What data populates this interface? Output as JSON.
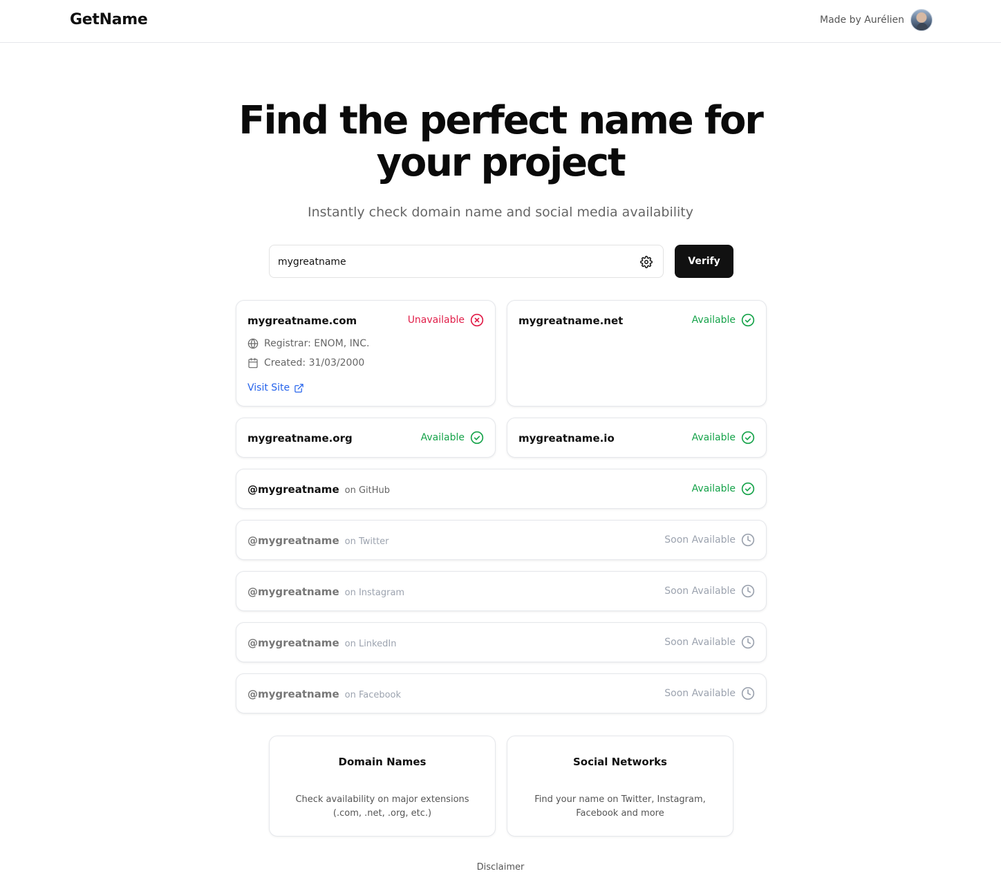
{
  "header": {
    "brand": "GetName",
    "made_by": "Made by Aurélien"
  },
  "hero": {
    "title": "Find the perfect name for your project",
    "subtitle": "Instantly check domain name and social media availability"
  },
  "search": {
    "value": "mygreatname",
    "verify_label": "Verify"
  },
  "domains": [
    {
      "name": "mygreatname.com",
      "status": "Unavailable",
      "registrar": "Registrar: ENOM, INC.",
      "created": "Created: 31/03/2000",
      "visit_label": "Visit Site"
    },
    {
      "name": "mygreatname.net",
      "status": "Available"
    },
    {
      "name": "mygreatname.org",
      "status": "Available"
    },
    {
      "name": "mygreatname.io",
      "status": "Available"
    }
  ],
  "socials": [
    {
      "handle": "@mygreatname",
      "platform": "on GitHub",
      "status": "Available"
    },
    {
      "handle": "@mygreatname",
      "platform": "on Twitter",
      "status": "Soon Available"
    },
    {
      "handle": "@mygreatname",
      "platform": "on Instagram",
      "status": "Soon Available"
    },
    {
      "handle": "@mygreatname",
      "platform": "on LinkedIn",
      "status": "Soon Available"
    },
    {
      "handle": "@mygreatname",
      "platform": "on Facebook",
      "status": "Soon Available"
    }
  ],
  "features": [
    {
      "title": "Domain Names",
      "description": "Check availability on major extensions (.com, .net, .org, etc.)"
    },
    {
      "title": "Social Networks",
      "description": "Find your name on Twitter, Instagram, Facebook and more"
    }
  ],
  "footer": {
    "disclaimer": "Disclaimer"
  },
  "colors": {
    "unavailable": "#e11d48",
    "available": "#16a34a",
    "soon": "#9ca3af",
    "link": "#2563eb",
    "button": "#111111"
  }
}
